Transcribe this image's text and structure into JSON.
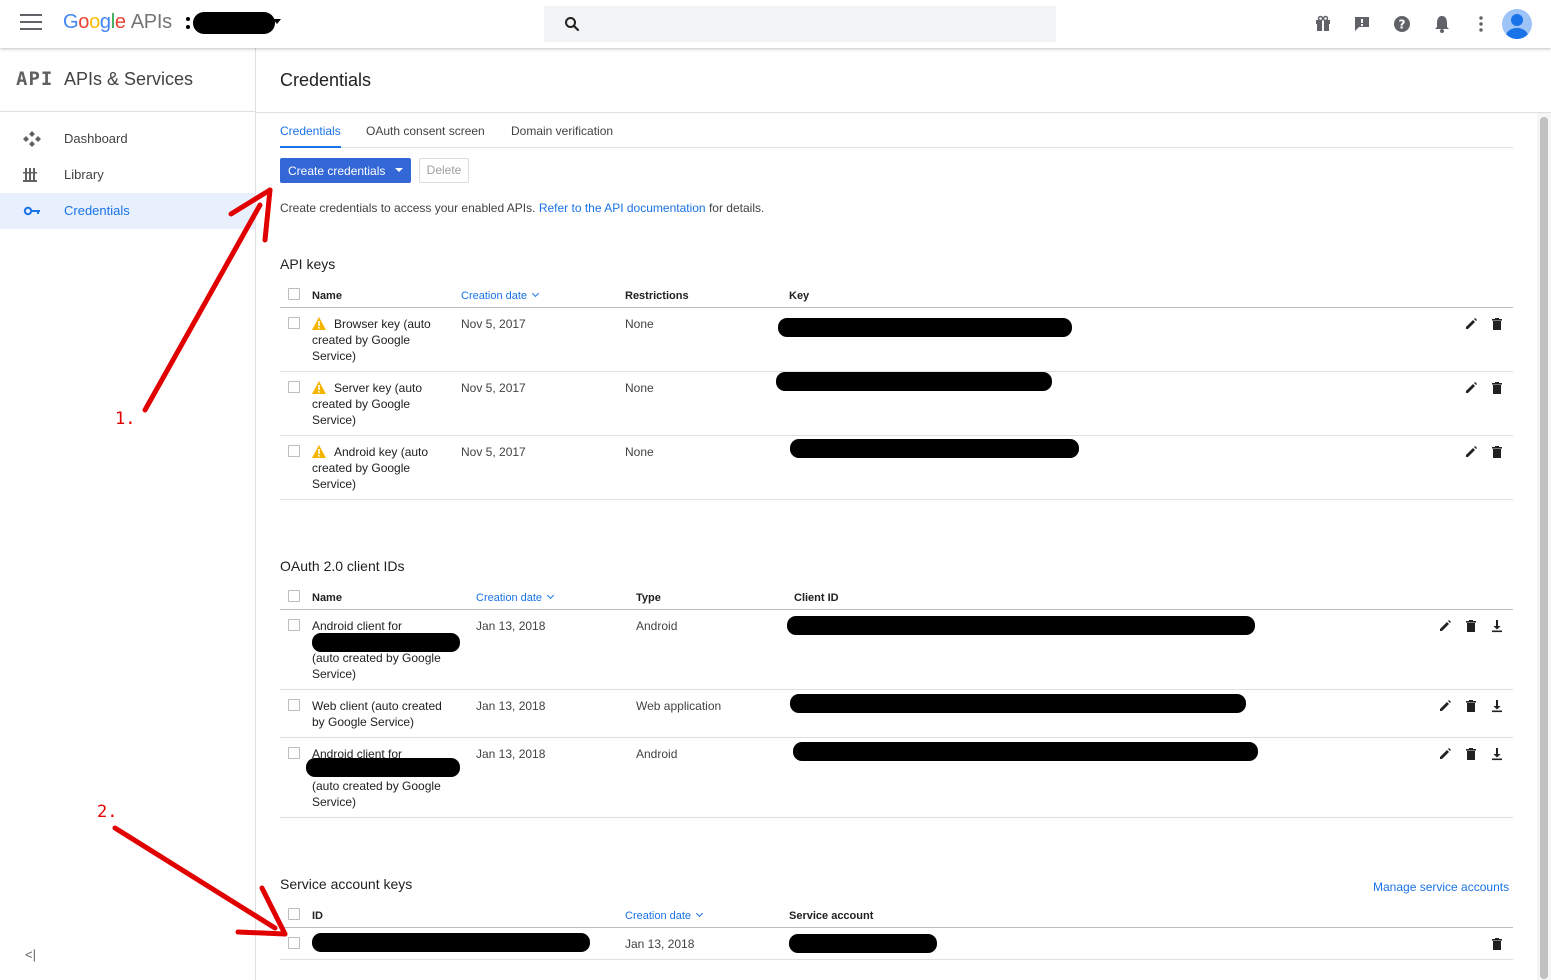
{
  "header": {
    "logo": {
      "google": "Google",
      "apis": "APIs"
    },
    "search_placeholder": ""
  },
  "sidebar": {
    "logo_text": "API",
    "title": "APIs & Services",
    "items": [
      {
        "label": "Dashboard",
        "icon": "dashboard-icon",
        "active": false
      },
      {
        "label": "Library",
        "icon": "library-icon",
        "active": false
      },
      {
        "label": "Credentials",
        "icon": "key-icon",
        "active": true
      }
    ],
    "collapse_label": "<|"
  },
  "page": {
    "title": "Credentials",
    "tabs": [
      "Credentials",
      "OAuth consent screen",
      "Domain verification"
    ],
    "create_button": "Create credentials",
    "delete_button": "Delete",
    "intro_text": "Create credentials to access your enabled APIs.",
    "intro_link": "Refer to the API documentation",
    "intro_suffix": "for details."
  },
  "api_keys": {
    "title": "API keys",
    "columns": [
      "Name",
      "Creation date",
      "Restrictions",
      "Key"
    ],
    "rows": [
      {
        "name": [
          "Browser key (auto",
          "created by Google",
          "Service)"
        ],
        "date": "Nov 5, 2017",
        "restrictions": "None"
      },
      {
        "name": [
          "Server key (auto",
          "created by Google",
          "Service)"
        ],
        "date": "Nov 5, 2017",
        "restrictions": "None"
      },
      {
        "name": [
          "Android key (auto",
          "created by Google",
          "Service)"
        ],
        "date": "Nov 5, 2017",
        "restrictions": "None"
      }
    ]
  },
  "oauth": {
    "title": "OAuth 2.0 client IDs",
    "columns": [
      "Name",
      "Creation date",
      "Type",
      "Client ID"
    ],
    "rows": [
      {
        "name": [
          "Android client for",
          "",
          "(auto created by Google",
          "Service)"
        ],
        "date": "Jan 13, 2018",
        "type": "Android"
      },
      {
        "name": [
          "Web client (auto created",
          "by Google Service)"
        ],
        "date": "Jan 13, 2018",
        "type": "Web application"
      },
      {
        "name": [
          "Android client for",
          "",
          "(auto created by Google",
          "Service)"
        ],
        "date": "Jan 13, 2018",
        "type": "Android"
      }
    ]
  },
  "service_accounts": {
    "title": "Service account keys",
    "manage_link": "Manage service accounts",
    "columns": [
      "ID",
      "Creation date",
      "Service account"
    ],
    "rows": [
      {
        "date": "Jan 13, 2018"
      }
    ]
  },
  "annotations": [
    "1.",
    "2."
  ],
  "colors": {
    "accent": "#1a73e8",
    "primary_button": "#3367d6",
    "arrow": "#e00000",
    "warning": "#f4b400"
  }
}
